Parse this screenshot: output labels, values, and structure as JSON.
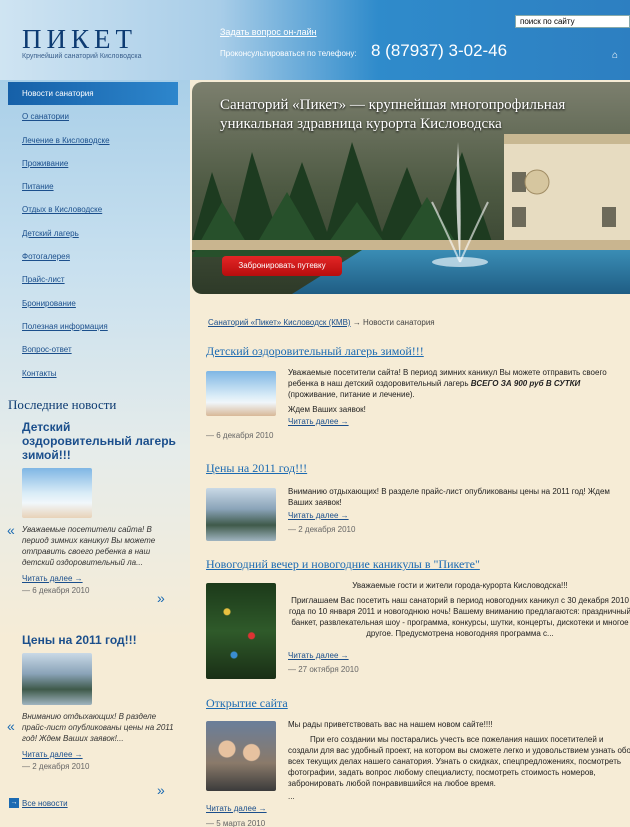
{
  "header": {
    "logo_title": "ПИКЕТ",
    "logo_subtitle": "Крупнейший санаторий Кисловодска",
    "ask_online": "Задать вопрос он-лайн",
    "phone_label": "Проконсультироваться по телефону:",
    "phone_number": "8 (87937) 3-02-46",
    "search_placeholder": "поиск по сайту",
    "home_icon": "home-icon"
  },
  "nav": {
    "items": [
      "Новости санатория",
      "О санатории",
      "Лечение в Кисловодске",
      "Проживание",
      "Питание",
      "Отдых в Кисловодске",
      "Детский лагерь",
      "Фотогалерея",
      "Прайс-лист",
      "Бронирование",
      "Полезная информация",
      "Вопрос-ответ",
      "Контакты"
    ],
    "active_index": 0
  },
  "banner": {
    "text": "Санаторий «Пикет» — крупнейшая многопрофильная уникальная здравница курорта Кисловодска",
    "button": "Забронировать путевку"
  },
  "sidebar": {
    "latest_title": "Последние новости",
    "news": [
      {
        "title": "Детский оздоровительный лагерь зимой!!!",
        "text": "Уважаемые посетители сайта! В период зимних каникул Вы можете отправить своего ребенка в наш детский оздоровительный ла...",
        "more": "Читать далее →",
        "date": "— 6 декабря 2010"
      },
      {
        "title": "Цены на 2011 год!!!",
        "text": "Вниманию отдыхающих! В разделе прайс-лист опубликованы цены на 2011 год! Ждем Ваших заявок!...",
        "more": "Читать далее →",
        "date": "— 2 декабря 2010"
      }
    ],
    "all_news": "Все новости"
  },
  "breadcrumb": {
    "link": "Санаторий «Пикет» Кисловодск (КМВ)",
    "current": "→ Новости санатория"
  },
  "posts": [
    {
      "title": "Детский оздоровительный лагерь зимой!!!",
      "body_1": "Уважаемые посетители сайта! В период зимних каникул Вы можете отправить своего ребенка в наш детский оздоровительный лагерь ",
      "body_bold": "ВСЕГО ЗА 900 руб В СУТКИ",
      "body_2": " (проживание, питание и лечение).",
      "body_3": "Ждем Ваших заявок!",
      "more": "Читать далее →",
      "date": "— 6 декабря 2010"
    },
    {
      "title": "Цены на 2011 год!!!",
      "body_1": "Вниманию отдыхающих! В разделе прайс-лист опубликованы цены на 2011 год! Ждем Ваших заявок!",
      "more": "Читать далее →",
      "date": "— 2 декабря 2010"
    },
    {
      "title": "Новогодний вечер и новогодние каникулы в \"Пикете\"",
      "body_1": "Уважаемые гости и жители города-курорта Кисловодска!!!",
      "body_2": "Приглашаем Вас посетить наш санаторий в период новогодних каникул с 30 декабря 2010 года по 10 января 2011 и новогоднюю ночь! Вашему вниманию предлагаются: праздничный банкет, развлекательная шоу - программа, конкурсы, шутки, концерты, дискотеки и многое другое. Предусмотрена новогодняя программа с...",
      "more": "Читать далее →",
      "date": "— 27 октября 2010"
    },
    {
      "title": "Открытие сайта",
      "body_1": "Мы рады приветствовать вас на нашем новом сайте!!!!",
      "body_2": "При его создании мы постарались учесть все пожелания наших посетителей и создали для вас удобный проект, на котором вы сможете легко и удовольствием узнать обо всех текущих делах нашего санатория. Узнать о скидках, спецпредложениях, посмотреть фотографии, задать вопрос любому специалисту, посмотреть стоимость номеров, забронировать любой понравившийся на любое время.",
      "body_3": "...",
      "more": "Читать далее →",
      "date": "— 5 марта 2010"
    }
  ]
}
